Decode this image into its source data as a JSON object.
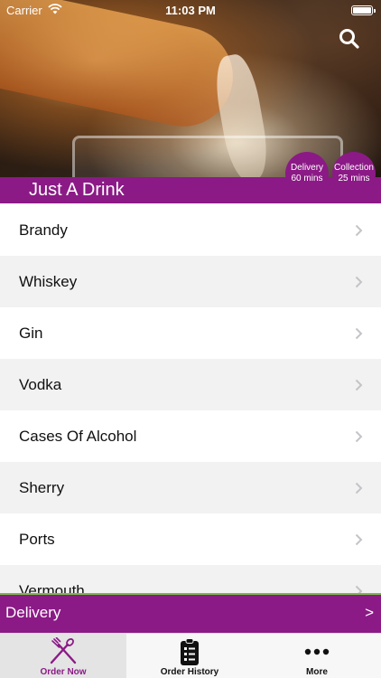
{
  "status_bar": {
    "carrier": "Carrier",
    "time": "11:03 PM"
  },
  "header": {
    "store_name": "Just A Drink",
    "delivery_badge": {
      "line1": "Delivery",
      "line2": "60 mins"
    },
    "collection_badge": {
      "line1": "Collection",
      "line2": "25 mins"
    }
  },
  "categories": [
    "Brandy",
    "Whiskey",
    "Gin",
    "Vodka",
    "Cases Of Alcohol",
    "Sherry",
    "Ports",
    "Vermouth"
  ],
  "delivery_bar": {
    "label": "Delivery",
    "arrow": ">"
  },
  "tab_bar": {
    "tabs": [
      {
        "label": "Order Now",
        "icon": "fork-knife-icon",
        "selected": true
      },
      {
        "label": "Order History",
        "icon": "clipboard-list-icon",
        "selected": false
      },
      {
        "label": "More",
        "icon": "more-dots-icon",
        "selected": false
      }
    ]
  },
  "colors": {
    "accent": "#8b1a86",
    "delivery_bar_border": "#7ab84a"
  }
}
